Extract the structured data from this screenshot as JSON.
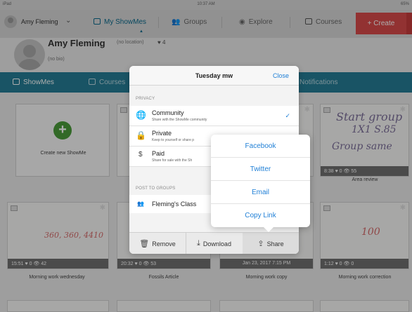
{
  "status_bar": {
    "device": "iPad",
    "time": "10:37 AM",
    "battery": "65%"
  },
  "top_nav": {
    "user_name": "Amy Fleming",
    "items": [
      "My ShowMes",
      "Groups",
      "Explore",
      "Courses"
    ],
    "create_label": "+ Create"
  },
  "profile": {
    "name": "Amy Fleming",
    "location": "(no location)",
    "likes": "4",
    "bio": "(no bio)"
  },
  "tabs": [
    "ShowMes",
    "Courses",
    "Notifications"
  ],
  "create_card": {
    "label": "Create new ShowMe"
  },
  "cards": [
    {
      "meta": "8:38  ♥ 0  👁 55",
      "title": "Area review"
    },
    {
      "meta": "15:51  ♥ 0  👁 42",
      "title": "Morning work wednesday"
    },
    {
      "meta": "20:32  ♥ 0  👁 53",
      "title": "Fossils Article"
    },
    {
      "meta": "Jan 23, 2017 7:15 PM",
      "title": "Morning work copy"
    },
    {
      "meta": "1:12  ♥ 0  👁 0",
      "title": "Morning work correction"
    }
  ],
  "modal": {
    "title": "Tuesday mw",
    "close_label": "Close",
    "privacy_label": "PRIVACY",
    "options": [
      {
        "title": "Community",
        "sub": "Share with the ShowMe community",
        "icon": "globe-icon",
        "selected": true
      },
      {
        "title": "Private",
        "sub": "Keep to yourself or share p",
        "icon": "lock-icon",
        "selected": false
      },
      {
        "title": "Paid",
        "sub": "Share for sale with the Sh",
        "icon": "dollar-icon",
        "selected": false
      }
    ],
    "groups_label": "POST TO GROUPS",
    "group_name": "Fleming's Class",
    "footer": {
      "remove": "Remove",
      "download": "Download",
      "share": "Share"
    }
  },
  "share_popover": {
    "items": [
      "Facebook",
      "Twitter",
      "Email",
      "Copy Link"
    ]
  },
  "colors": {
    "teal": "#257d95",
    "create_red": "#d84a4a",
    "link_blue": "#1f7fd6"
  }
}
